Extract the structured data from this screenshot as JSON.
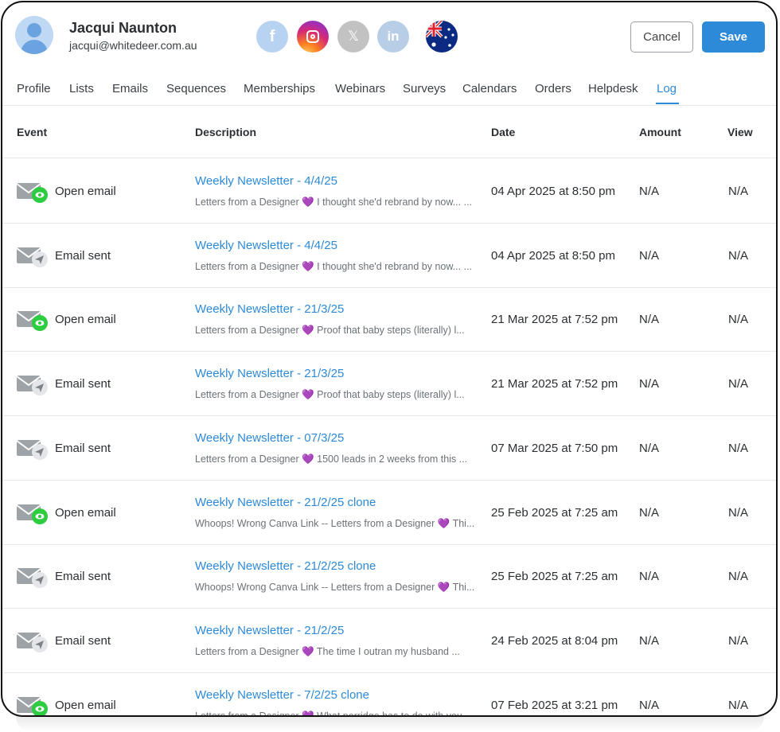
{
  "user": {
    "name": "Jacqui Naunton",
    "email": "jacqui@whitedeer.com.au"
  },
  "social": {
    "facebook": "f",
    "twitter": "𝕏",
    "linkedin": "in"
  },
  "actions": {
    "cancel": "Cancel",
    "save": "Save"
  },
  "tabs": [
    "Profile",
    "Lists",
    "Emails",
    "Sequences",
    "Memberships",
    "Webinars",
    "Surveys",
    "Calendars",
    "Orders",
    "Helpdesk",
    "Log"
  ],
  "active_tab": "Log",
  "table": {
    "headers": {
      "event": "Event",
      "description": "Description",
      "date": "Date",
      "amount": "Amount",
      "view": "View"
    },
    "rows": [
      {
        "icon": "open",
        "event": "Open email",
        "title": "Weekly Newsletter - 4/4/25",
        "subtitle": "Letters from a Designer 💜 I thought she'd rebrand by now... ...",
        "date": "04 Apr 2025 at 8:50 pm",
        "amount": "N/A",
        "view": "N/A"
      },
      {
        "icon": "sent",
        "event": "Email sent",
        "title": "Weekly Newsletter - 4/4/25",
        "subtitle": "Letters from a Designer 💜 I thought she'd rebrand by now... ...",
        "date": "04 Apr 2025 at 8:50 pm",
        "amount": "N/A",
        "view": "N/A"
      },
      {
        "icon": "open",
        "event": "Open email",
        "title": "Weekly Newsletter - 21/3/25",
        "subtitle": "Letters from a Designer 💜 Proof that baby steps (literally) l...",
        "date": "21 Mar 2025 at 7:52 pm",
        "amount": "N/A",
        "view": "N/A"
      },
      {
        "icon": "sent",
        "event": "Email sent",
        "title": "Weekly Newsletter - 21/3/25",
        "subtitle": "Letters from a Designer 💜 Proof that baby steps (literally) l...",
        "date": "21 Mar 2025 at 7:52 pm",
        "amount": "N/A",
        "view": "N/A"
      },
      {
        "icon": "sent",
        "event": "Email sent",
        "title": "Weekly Newsletter - 07/3/25",
        "subtitle": "Letters from a Designer 💜 1500 leads in 2 weeks from this ...",
        "date": "07 Mar 2025 at 7:50 pm",
        "amount": "N/A",
        "view": "N/A"
      },
      {
        "icon": "open",
        "event": "Open email",
        "title": "Weekly Newsletter - 21/2/25 clone",
        "subtitle": "Whoops! Wrong Canva Link -- Letters from a Designer 💜 Thi...",
        "date": "25 Feb 2025 at 7:25 am",
        "amount": "N/A",
        "view": "N/A"
      },
      {
        "icon": "sent",
        "event": "Email sent",
        "title": "Weekly Newsletter - 21/2/25 clone",
        "subtitle": "Whoops! Wrong Canva Link -- Letters from a Designer 💜 Thi...",
        "date": "25 Feb 2025 at 7:25 am",
        "amount": "N/A",
        "view": "N/A"
      },
      {
        "icon": "sent",
        "event": "Email sent",
        "title": "Weekly Newsletter - 21/2/25",
        "subtitle": "Letters from a Designer 💜 The time I outran my husband ...",
        "date": "24 Feb 2025 at 8:04 pm",
        "amount": "N/A",
        "view": "N/A"
      },
      {
        "icon": "open",
        "event": "Open email",
        "title": "Weekly Newsletter - 7/2/25 clone",
        "subtitle": "Letters from a Designer 💜 What porridge has to do with you...",
        "date": "07 Feb 2025 at 3:21 pm",
        "amount": "N/A",
        "view": "N/A"
      }
    ]
  },
  "colors": {
    "accent": "#2d8ad8",
    "open_badge": "#2ecc40",
    "sent_badge": "#e4e6e9",
    "heart": "#a64fd8"
  }
}
